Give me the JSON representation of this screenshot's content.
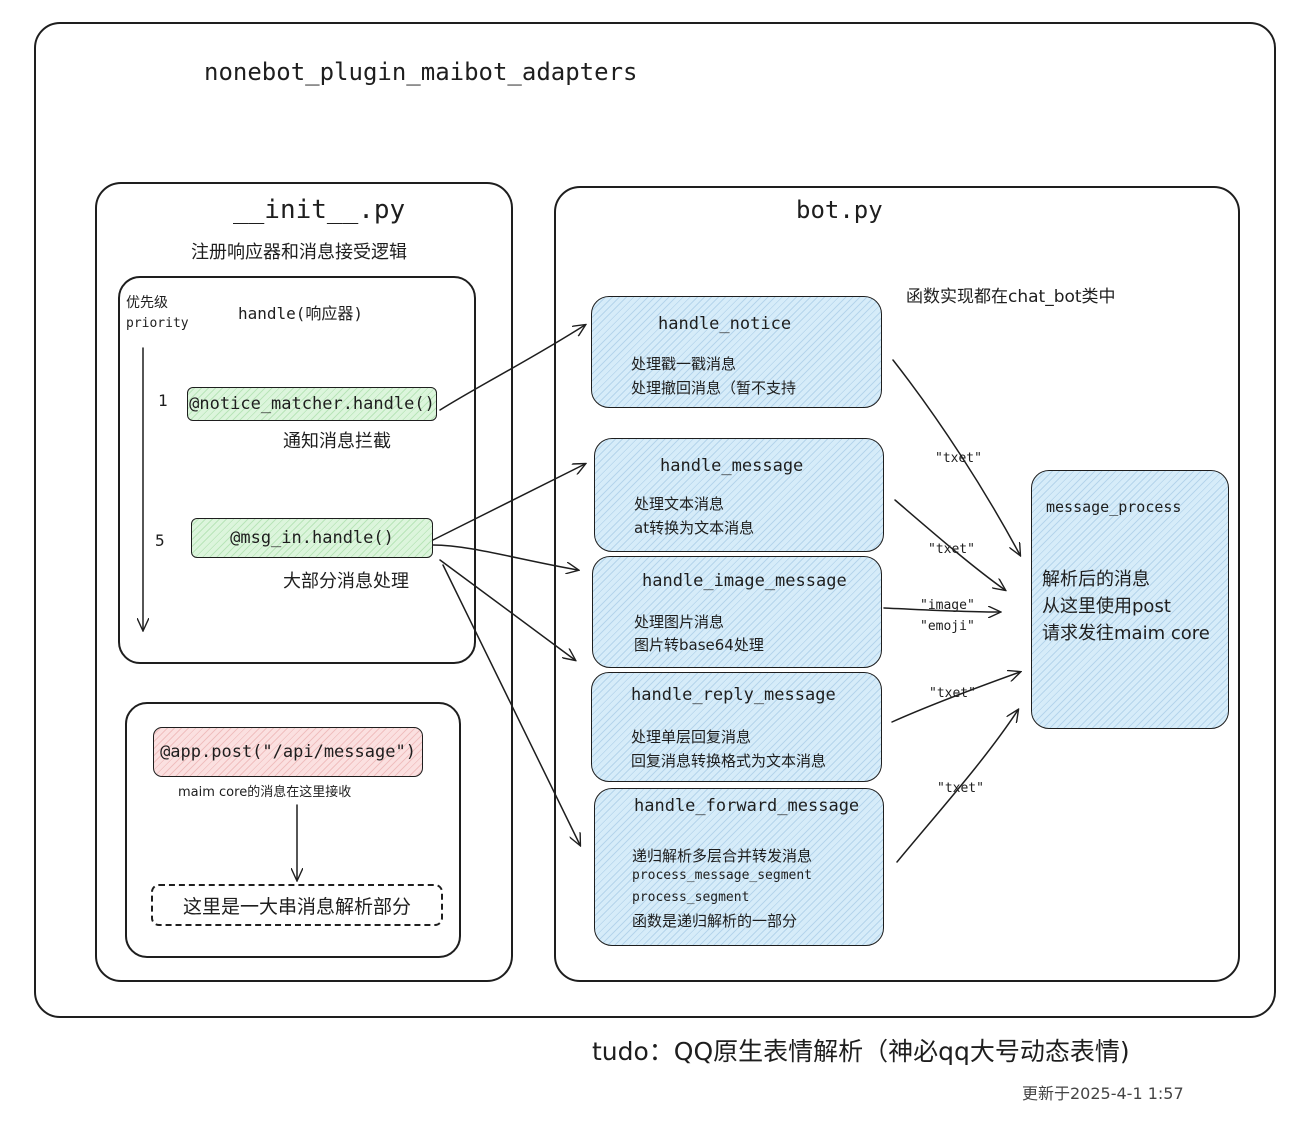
{
  "title": "nonebot_plugin_maibot_adapters",
  "init_panel": {
    "title": "__init__.py",
    "subtitle": "注册响应器和消息接受逻辑",
    "handle_box": {
      "title": "handle(响应器)",
      "priority_label_cn": "优先级",
      "priority_label_en": "priority",
      "handlers": [
        {
          "priority": "1",
          "code": "@notice_matcher.handle()",
          "caption": "通知消息拦截"
        },
        {
          "priority": "5",
          "code": "@msg_in.handle()",
          "caption": "大部分消息处理"
        }
      ]
    },
    "post_box": {
      "code": "@app.post(\"/api/message\")",
      "caption": "maim core的消息在这里接收",
      "target": "这里是一大串消息解析部分"
    }
  },
  "bot_panel": {
    "title": "bot.py",
    "note": "函数实现都在chat_bot类中",
    "handlers": [
      {
        "name": "handle_notice",
        "lines": [
          "处理戳一戳消息",
          "处理撤回消息（暂不支持"
        ]
      },
      {
        "name": "handle_message",
        "lines": [
          "处理文本消息",
          "at转换为文本消息"
        ]
      },
      {
        "name": "handle_image_message",
        "lines": [
          "处理图片消息",
          "图片转base64处理"
        ]
      },
      {
        "name": "handle_reply_message",
        "lines": [
          "处理单层回复消息",
          "回复消息转换格式为文本消息"
        ]
      },
      {
        "name": "handle_forward_message",
        "lines": [
          "递归解析多层合并转发消息",
          "process_message_segment",
          "process_segment",
          "函数是递归解析的一部分"
        ]
      }
    ],
    "edge_labels": [
      "\"txet\"",
      "\"txet\"",
      "\"image\"",
      "\"emoji\"",
      "\"txet\"",
      "\"txet\""
    ],
    "process": {
      "name": "message_process",
      "lines": [
        "解析后的消息",
        "从这里使用post",
        "请求发往maim core"
      ]
    }
  },
  "todo": "tudo：QQ原生表情解析（神必qq大号动态表情)",
  "updated": "更新于2025-4-1 1:57"
}
